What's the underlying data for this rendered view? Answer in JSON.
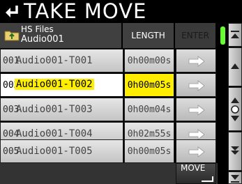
{
  "title": "TAKE MOVE",
  "header": {
    "folder_line1": "HS Files",
    "folder_line2": "Audio001",
    "length_label": "LENGTH",
    "enter_label": "ENTER"
  },
  "files": [
    {
      "num": "001",
      "name": "Audio001-T001",
      "length": "0h00m00s"
    },
    {
      "num": "002",
      "name": "Audio001-T002",
      "length": "0h00m05s",
      "selected": true
    },
    {
      "num": "003",
      "name": "Audio001-T003",
      "length": "0h00m04s"
    },
    {
      "num": "004",
      "name": "Audio001-T004",
      "length": "0h02m55s"
    },
    {
      "num": "005",
      "name": "Audio001-T005",
      "length": "0h00m05s"
    }
  ],
  "footer": {
    "move_label": "MOVE"
  },
  "colors": {
    "selected": "#ffee00",
    "scroll_indicator": "#66ff33"
  }
}
